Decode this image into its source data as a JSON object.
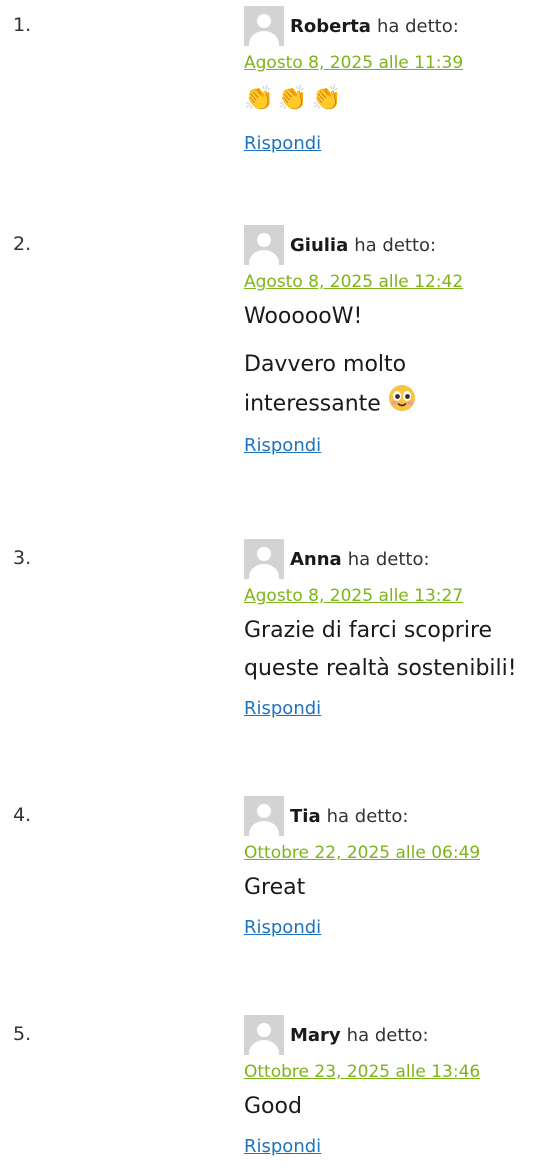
{
  "comments": [
    {
      "number": "1.",
      "author": "Roberta",
      "says": "ha detto:",
      "date": "Agosto 8, 2025 alle 11:39",
      "paragraphs": [],
      "emoji_text": "👏👏👏",
      "reply_label": "Rispondi"
    },
    {
      "number": "2.",
      "author": "Giulia",
      "says": "ha detto:",
      "date": "Agosto 8, 2025 alle 12:42",
      "paragraphs": [
        "WoooooW!",
        "Davvero molto interessante"
      ],
      "emoji_text": "",
      "reply_label": "Rispondi"
    },
    {
      "number": "3.",
      "author": "Anna",
      "says": "ha detto:",
      "date": "Agosto 8, 2025 alle 13:27",
      "paragraphs": [
        "Grazie di farci scoprire queste realtà sostenibili!"
      ],
      "emoji_text": "",
      "reply_label": "Rispondi"
    },
    {
      "number": "4.",
      "author": "Tia",
      "says": "ha detto:",
      "date": "Ottobre 22, 2025 alle 06:49",
      "paragraphs": [
        "Great"
      ],
      "emoji_text": "",
      "reply_label": "Rispondi"
    },
    {
      "number": "5.",
      "author": "Mary",
      "says": "ha detto:",
      "date": "Ottobre 23, 2025 alle 13:46",
      "paragraphs": [
        "Good"
      ],
      "emoji_text": "",
      "reply_label": "Rispondi"
    }
  ],
  "colors": {
    "date_link": "#7cb518",
    "reply_link": "#1e73be",
    "avatar_bg": "#d3d3d3"
  },
  "icons": {
    "avatar": "default-avatar-icon",
    "clap": "clapping-hands-emoji",
    "smile": "smiling-face-emoji"
  }
}
